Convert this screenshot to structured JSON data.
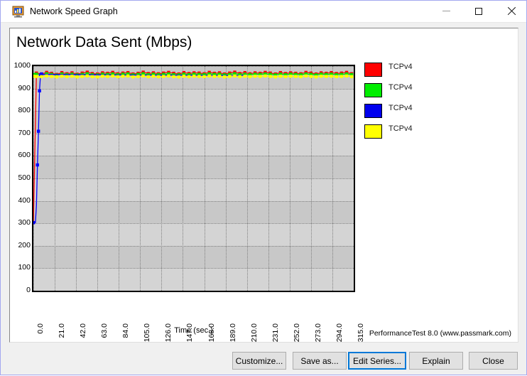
{
  "window": {
    "title": "Network Speed Graph",
    "icon": "network-graph-icon",
    "controls": {
      "minimize": "minimize-icon",
      "maximize": "maximize-icon",
      "close": "close-icon"
    }
  },
  "chart_data": {
    "type": "line",
    "title": "Network Data Sent (Mbps)",
    "xlabel": "Time (sec.)",
    "ylabel": "",
    "xlim": [
      0.0,
      315.0
    ],
    "ylim": [
      0,
      1000
    ],
    "grid": true,
    "legend_position": "right",
    "ytick_labels": [
      "1000",
      "900",
      "800",
      "700",
      "600",
      "500",
      "400",
      "300",
      "200",
      "100",
      "0"
    ],
    "ytick_values": [
      1000,
      900,
      800,
      700,
      600,
      500,
      400,
      300,
      200,
      100,
      0
    ],
    "xtick_labels": [
      "0.0",
      "21.0",
      "42.0",
      "63.0",
      "84.0",
      "105.0",
      "126.0",
      "147.0",
      "168.0",
      "189.0",
      "210.0",
      "231.0",
      "252.0",
      "273.0",
      "294.0",
      "315.0"
    ],
    "xtick_values": [
      0.0,
      21.0,
      42.0,
      63.0,
      84.0,
      105.0,
      126.0,
      147.0,
      168.0,
      189.0,
      210.0,
      231.0,
      252.0,
      273.0,
      294.0,
      315.0
    ],
    "series": [
      {
        "name": "TCPv4",
        "color": "#ff0000",
        "x": [
          0,
          3,
          8,
          13,
          18,
          23,
          28,
          33,
          38,
          43,
          48,
          53,
          58,
          63,
          68,
          73,
          78,
          83,
          88,
          93,
          98,
          103,
          108,
          113,
          118,
          123,
          128,
          133,
          138,
          143,
          148,
          153,
          158,
          163,
          168,
          173,
          178,
          183,
          188,
          193,
          198,
          203,
          208,
          213,
          218,
          223,
          228,
          233,
          238,
          243,
          248,
          253,
          258,
          263,
          268,
          273,
          278,
          283,
          288,
          293,
          298,
          303,
          308,
          313
        ],
        "y": [
          303,
          969,
          965,
          972,
          968,
          963,
          971,
          966,
          970,
          964,
          969,
          973,
          967,
          965,
          970,
          968,
          972,
          966,
          969,
          971,
          965,
          968,
          973,
          967,
          970,
          966,
          969,
          972,
          968,
          965,
          971,
          967,
          970,
          969,
          966,
          972,
          968,
          970,
          965,
          969,
          973,
          967,
          971,
          966,
          970,
          968,
          972,
          969,
          965,
          971,
          967,
          970,
          968,
          966,
          972,
          969,
          965,
          970,
          968,
          971,
          967,
          969,
          972,
          966
        ]
      },
      {
        "name": "TCPv4",
        "color": "#00e000",
        "x": [
          0,
          3,
          8,
          13,
          18,
          23,
          28,
          33,
          38,
          43,
          48,
          53,
          58,
          63,
          68,
          73,
          78,
          83,
          88,
          93,
          98,
          103,
          108,
          113,
          118,
          123,
          128,
          133,
          138,
          143,
          148,
          153,
          158,
          163,
          168,
          173,
          178,
          183,
          188,
          193,
          198,
          203,
          208,
          213,
          218,
          223,
          228,
          233,
          238,
          243,
          248,
          253,
          258,
          263,
          268,
          273,
          278,
          283,
          288,
          293,
          298,
          303,
          308,
          313
        ],
        "y": [
          963,
          964,
          962,
          966,
          963,
          960,
          965,
          962,
          964,
          961,
          963,
          966,
          962,
          961,
          964,
          963,
          965,
          962,
          964,
          965,
          961,
          963,
          966,
          962,
          964,
          962,
          963,
          965,
          962,
          961,
          964,
          962,
          964,
          963,
          962,
          965,
          963,
          964,
          961,
          963,
          966,
          962,
          964,
          962,
          964,
          963,
          965,
          963,
          961,
          964,
          962,
          964,
          963,
          962,
          965,
          963,
          961,
          964,
          963,
          964,
          962,
          963,
          965,
          962
        ]
      },
      {
        "name": "TCPv4",
        "color": "#0000ff",
        "x": [
          0,
          2,
          3,
          4,
          5,
          6,
          7,
          8,
          9,
          100,
          205,
          208
        ],
        "y": [
          303,
          303,
          380,
          560,
          710,
          890,
          960,
          965,
          963,
          960,
          958,
          962
        ]
      },
      {
        "name": "TCPv4",
        "color": "#ffff00",
        "x": [
          0,
          3,
          8,
          13,
          18,
          23,
          28,
          33,
          38,
          43,
          48,
          53,
          58,
          63,
          68,
          73,
          78,
          83,
          88,
          93,
          98,
          103,
          108,
          113,
          118,
          123,
          128,
          133,
          138,
          143,
          148,
          153,
          158,
          163,
          168,
          173,
          178,
          183,
          188,
          193,
          198,
          203,
          208,
          213,
          218,
          223,
          228,
          233,
          238,
          243,
          248,
          253,
          258,
          263,
          268,
          273,
          278,
          283,
          288,
          293,
          298,
          303,
          308,
          313
        ],
        "y": [
          955,
          954,
          953,
          956,
          954,
          952,
          955,
          953,
          955,
          952,
          954,
          956,
          953,
          952,
          955,
          954,
          956,
          953,
          955,
          956,
          952,
          954,
          956,
          953,
          955,
          953,
          954,
          956,
          953,
          952,
          955,
          953,
          955,
          954,
          953,
          956,
          954,
          955,
          952,
          954,
          956,
          953,
          955,
          953,
          955,
          954,
          956,
          954,
          952,
          955,
          953,
          955,
          954,
          953,
          956,
          954,
          952,
          955,
          954,
          955,
          953,
          954,
          956,
          953
        ]
      }
    ],
    "legend": [
      {
        "label": "TCPv4",
        "color": "#ff0000"
      },
      {
        "label": "TCPv4",
        "color": "#00ee00"
      },
      {
        "label": "TCPv4",
        "color": "#0000ee"
      },
      {
        "label": "TCPv4",
        "color": "#ffff00"
      }
    ],
    "footer": "PerformanceTest 8.0 (www.passmark.com)"
  },
  "buttons": {
    "customize": "Customize...",
    "save_as": "Save as...",
    "edit_series": "Edit Series...",
    "explain": "Explain",
    "close": "Close"
  }
}
